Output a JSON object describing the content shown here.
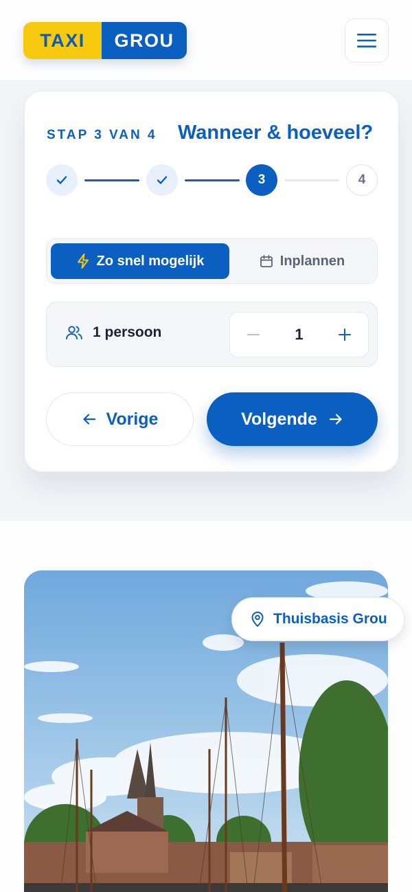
{
  "header": {
    "logo_part1": "TAXI",
    "logo_part2": "GROU",
    "menu_icon": "hamburger-menu-icon"
  },
  "form": {
    "step_label": "STAP 3 VAN 4",
    "title": "Wanneer & hoeveel?",
    "steps": [
      {
        "state": "done",
        "label": "✓"
      },
      {
        "state": "done",
        "label": "✓"
      },
      {
        "state": "active",
        "label": "3"
      },
      {
        "state": "todo",
        "label": "4"
      }
    ],
    "timing": {
      "asap_label": "Zo snel mogelijk",
      "schedule_label": "Inplannen",
      "selected": "asap"
    },
    "passengers": {
      "label": "1 persoon",
      "count": "1"
    },
    "prev_label": "Vorige",
    "next_label": "Volgende"
  },
  "location_badge": {
    "label": "Thuisbasis Grou"
  },
  "colors": {
    "primary": "#0a5fc0",
    "accent_yellow": "#f7c90f",
    "sky": "#8fbde6"
  }
}
